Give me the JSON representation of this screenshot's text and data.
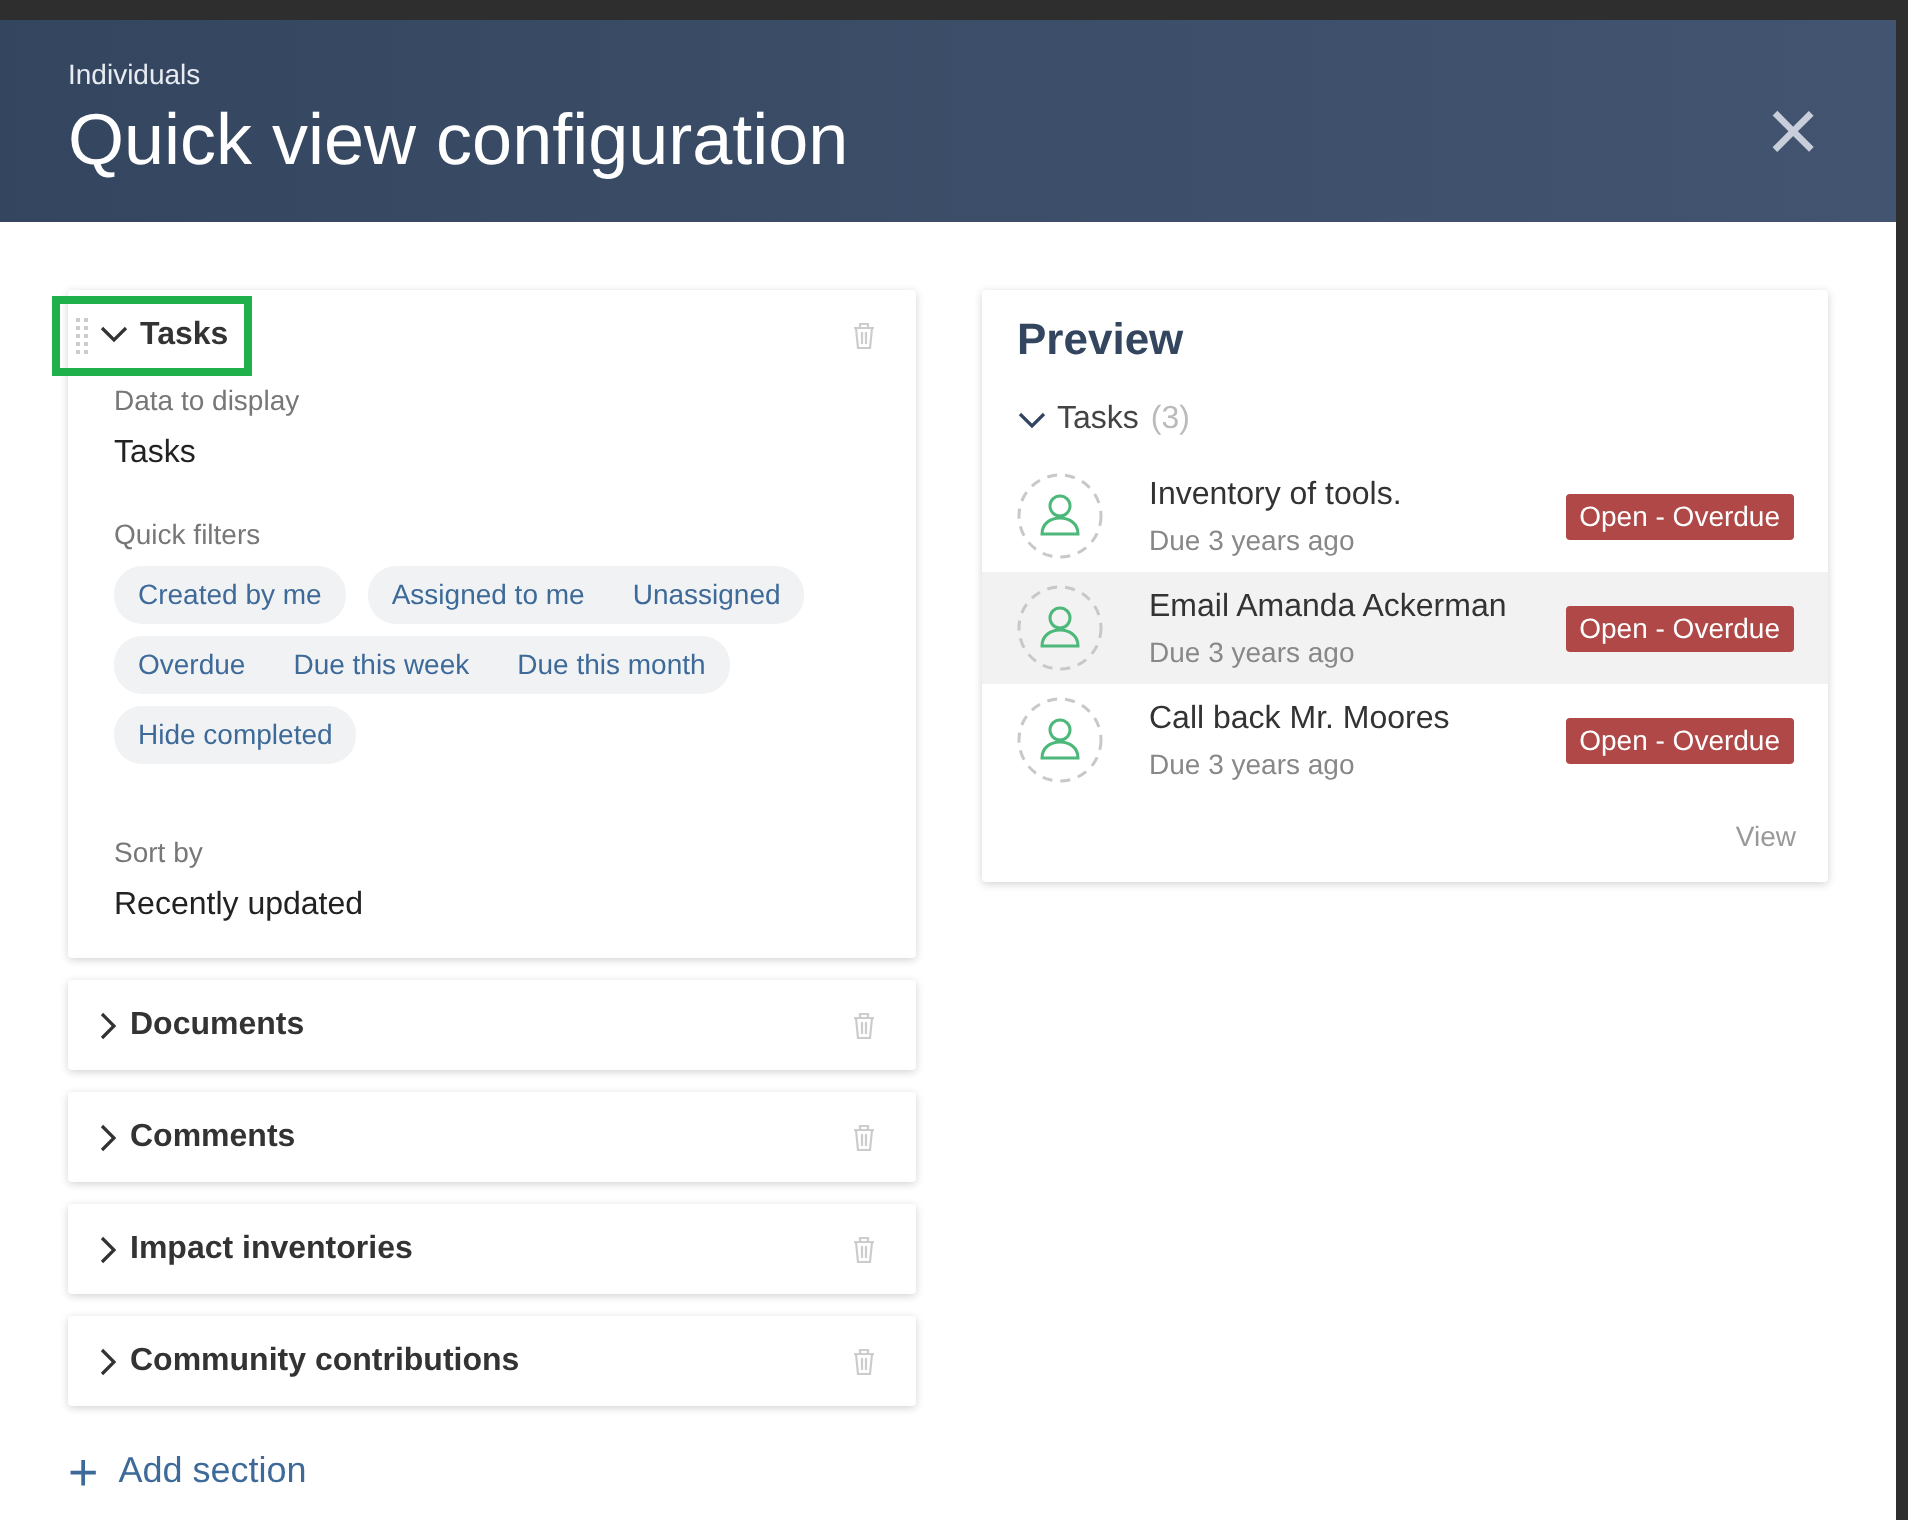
{
  "dialog": {
    "subtitle": "Individuals",
    "title": "Quick view configuration",
    "close": "×"
  },
  "sections": [
    {
      "title": "Tasks",
      "expanded": true,
      "focused": true,
      "fields": [
        {
          "kind": "text",
          "label": "Data to display",
          "value": "Tasks"
        },
        {
          "kind": "filters",
          "label": "Quick filters",
          "groups": [
            [
              "Created by me"
            ],
            [
              "Assigned to me",
              "Unassigned"
            ],
            [
              "Overdue",
              "Due this week",
              "Due this month"
            ],
            [
              "Hide completed"
            ]
          ]
        },
        {
          "kind": "text",
          "label": "Sort by",
          "value": "Recently updated"
        }
      ]
    },
    {
      "title": "Documents",
      "expanded": false,
      "focused": false
    },
    {
      "title": "Comments",
      "expanded": false,
      "focused": false
    },
    {
      "title": "Impact inventories",
      "expanded": false,
      "focused": false
    },
    {
      "title": "Community contributions",
      "expanded": false,
      "focused": false
    }
  ],
  "add_section": {
    "icon": "+",
    "label": "Add section"
  },
  "preview": {
    "title": "Preview",
    "group": {
      "title": "Tasks",
      "count": "(3)",
      "expanded": true
    },
    "items": [
      {
        "title": "Inventory of tools.",
        "due": "Due 3 years ago",
        "status": "Open - Overdue",
        "highlighted": false
      },
      {
        "title": "Email Amanda Ackerman",
        "due": "Due 3 years ago",
        "status": "Open - Overdue",
        "highlighted": true
      },
      {
        "title": "Call back Mr. Moores",
        "due": "Due 3 years ago",
        "status": "Open - Overdue",
        "highlighted": false
      }
    ],
    "view_link": "View"
  }
}
